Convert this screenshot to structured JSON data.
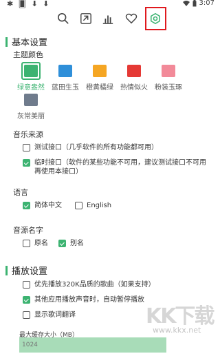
{
  "status": {
    "left_icons": "✱ 🂠 ⬇ ⬇",
    "time": "3:07"
  },
  "toolbar": {
    "icons": [
      "search-icon",
      "download-box-icon",
      "chart-icon",
      "heart-icon",
      "settings-gear-icon"
    ]
  },
  "basic": {
    "title": "基本设置",
    "theme_label": "主题颜色",
    "themes": [
      {
        "name": "绿意盎然",
        "color": "#3cb371",
        "selected": true
      },
      {
        "name": "蓝田生玉",
        "color": "#2f8fd9",
        "selected": false
      },
      {
        "name": "橙黄橘绿",
        "color": "#f5a623",
        "selected": false
      },
      {
        "name": "热情似火",
        "color": "#e53935",
        "selected": false
      },
      {
        "name": "粉装玉琢",
        "color": "#f28a99",
        "selected": false
      },
      {
        "name": "灰常美丽",
        "color": "#6f7b8c",
        "selected": false
      }
    ],
    "music_source_label": "音乐来源",
    "sources": [
      {
        "text": "测试接口（几乎软件的所有功能都可用）",
        "checked": false
      },
      {
        "text": "临时接口（软件的某些功能不可用，建议测试接口不可用再使用本接口）",
        "checked": true
      }
    ],
    "language_label": "语言",
    "languages": [
      {
        "text": "简体中文",
        "checked": true
      },
      {
        "text": "English",
        "checked": false
      }
    ],
    "source_name_label": "音源名字",
    "names": [
      {
        "text": "原名",
        "checked": false
      },
      {
        "text": "别名",
        "checked": true
      }
    ]
  },
  "playback": {
    "title": "播放设置",
    "options": [
      {
        "text": "优先播放320K品质的歌曲（如果支持）",
        "checked": false
      },
      {
        "text": "其他应用播放声音时，自动暂停播放",
        "checked": true
      },
      {
        "text": "显示歌词翻译",
        "checked": false
      }
    ],
    "cache_label": "最大缓存大小（MB）",
    "cache_placeholder": "1024"
  },
  "watermark": {
    "logo": "KK下载",
    "url": "www.kkx.net"
  },
  "colors": {
    "accent": "#3cb371",
    "highlight_box": "#e0191e"
  }
}
